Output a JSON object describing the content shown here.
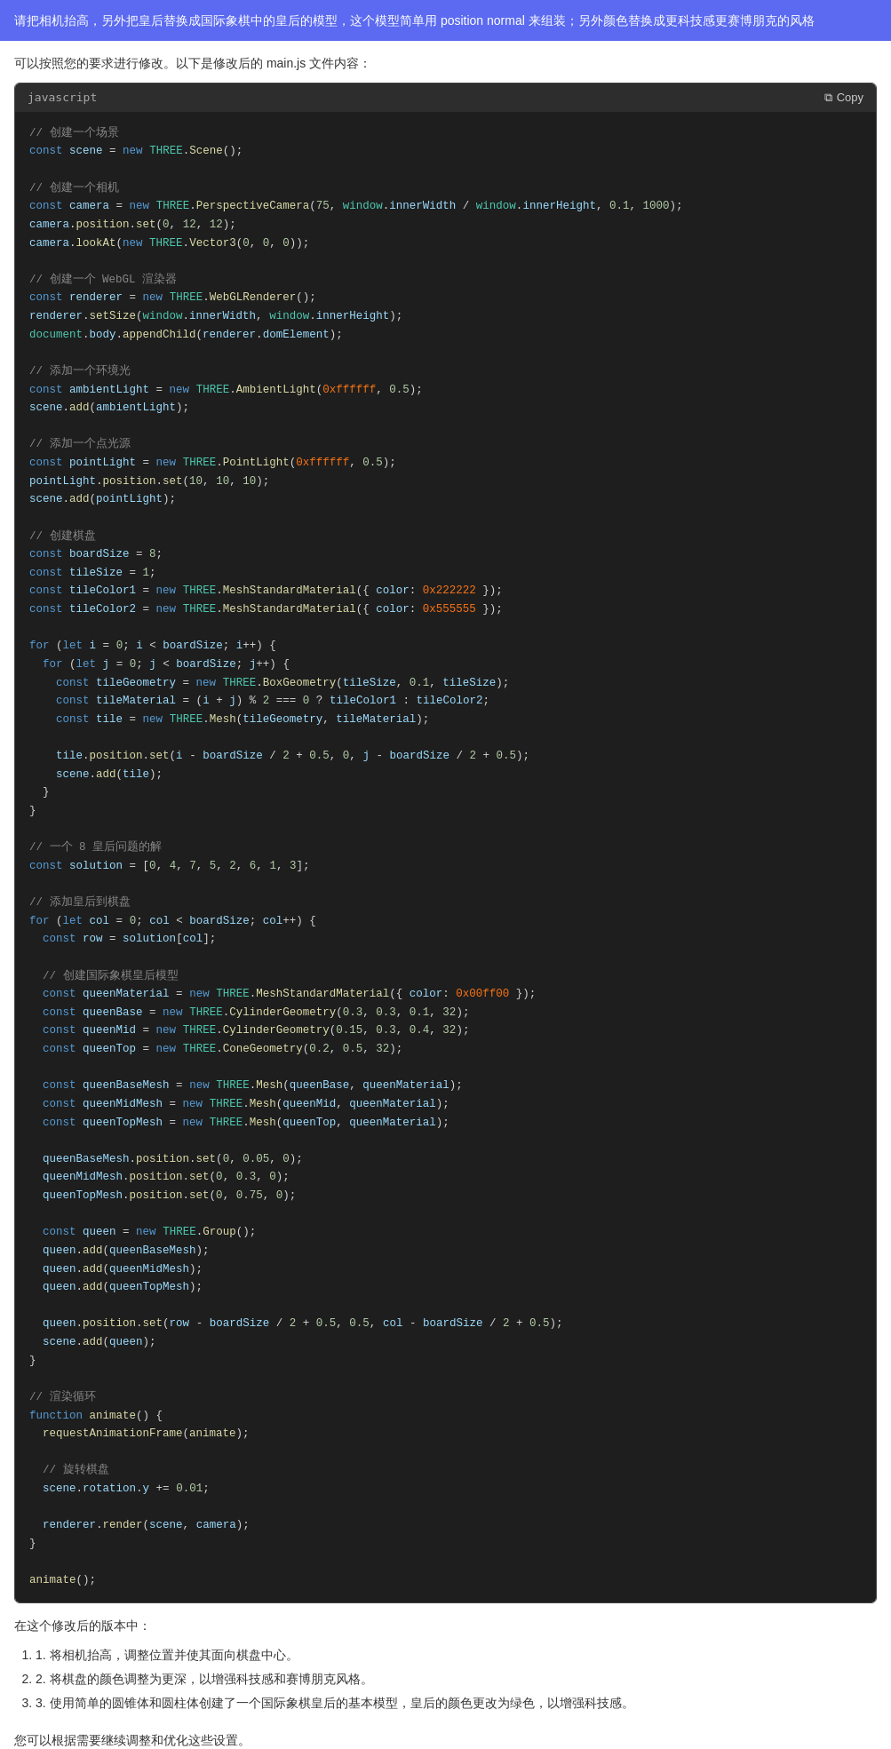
{
  "prompt_banner": {
    "text": "请把相机抬高，另外把皇后替换成国际象棋中的皇后的模型，这个模型简单用 position normal 来组装；另外颜色替换成更科技感更赛博朋克的风格"
  },
  "intro": {
    "text": "可以按照您的要求进行修改。以下是修改后的 main.js 文件内容："
  },
  "code_block": {
    "lang": "javascript",
    "copy_label": "Copy",
    "copy_icon": "📋"
  },
  "summary": {
    "intro": "在这个修改后的版本中：",
    "items": [
      "1. 将相机抬高，调整位置并使其面向棋盘中心。",
      "2. 将棋盘的颜色调整为更深，以增强科技感和赛博朋克风格。",
      "3. 使用简单的圆锥体和圆柱体创建了一个国际象棋皇后的基本模型，皇后的颜色更改为绿色，以增强科技感。"
    ]
  },
  "footer": {
    "text": "您可以根据需要继续调整和优化这些设置。"
  }
}
